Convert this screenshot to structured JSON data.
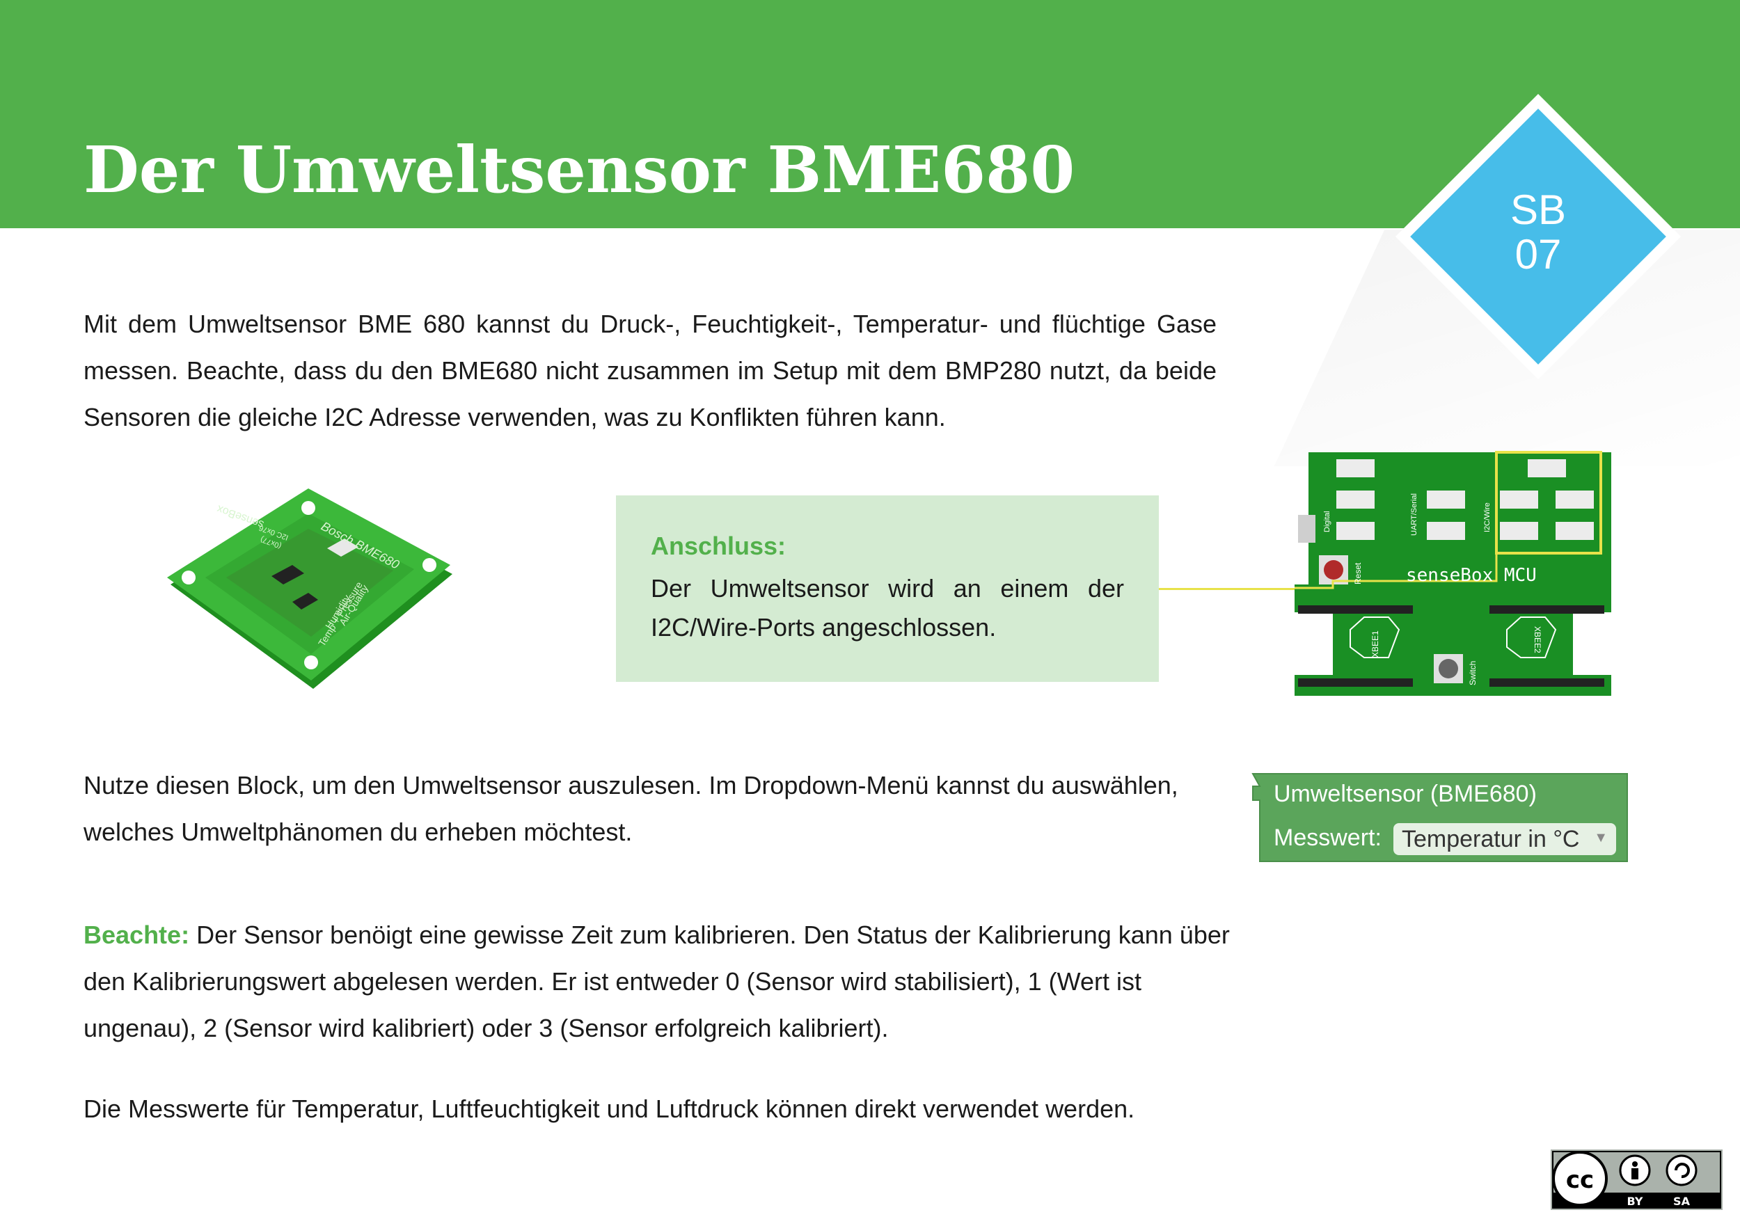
{
  "header": {
    "title": "Der Umweltsensor BME680",
    "badge_line1": "SB",
    "badge_line2": "07",
    "color": "#52b04b",
    "badge_color": "#47bde9"
  },
  "intro": "Mit dem Umweltsensor BME 680 kannst du Druck-, Feuchtigkeit-, Temperatur- und flüchtige Gase messen. Beachte, dass du den BME680 nicht zusammen im Setup mit dem BMP280 nutzt, da beide Sensoren die gleiche I2C Adresse verwenden, was zu Konflikten führen kann.",
  "sensor_board": {
    "brand": "Bosch BME680",
    "maker": "senseBox",
    "label1": "Temp + Pressure",
    "label2": "Humidity",
    "label3": "Air-Quality",
    "label4": "I2C 0x76",
    "label5": "(0x77)",
    "icon": "bme680-sensor-board"
  },
  "connection_box": {
    "heading": "Anschluss:",
    "text": "Der Umweltsensor wird an einem der I2C/Wire-Ports angeschlossen.",
    "bg_color": "#d4ebd2"
  },
  "mcu_board": {
    "name": "senseBox MCU",
    "reset_label": "Reset",
    "switch_label": "Switch",
    "xbee1": "XBEE1",
    "xbee2": "XBEE2",
    "digital_label": "Digital",
    "uart_label": "UART/Serial",
    "i2c_label": "I2C/Wire",
    "icon": "sensebox-mcu-board"
  },
  "block_text": "Nutze diesen Block, um den Umweltsensor auszulesen. Im Dropdown-Menü kannst du auswählen, welches Umweltphänomen du erheben möchtest.",
  "block": {
    "title": "Umweltsensor (BME680)",
    "label": "Messwert:",
    "dropdown_value": "Temperatur in °C",
    "color": "#5ba55b"
  },
  "note": {
    "prefix": "Beachte:",
    "text": " Der Sensor benöigt eine gewisse Zeit zum kalibrieren. Den Status der Kalibrierung kann über den Kalibrierungswert abgelesen werden. Er ist entweder 0 (Sensor wird stabilisiert), 1 (Wert ist ungenau), 2 (Sensor wird kalibriert) oder 3 (Sensor erfolgreich kalibriert)."
  },
  "final": "Die Messwerte für Temperatur, Luftfeuchtigkeit und Luftdruck können direkt verwendet werden.",
  "license": {
    "cc": "cc",
    "by": "BY",
    "sa": "SA"
  }
}
